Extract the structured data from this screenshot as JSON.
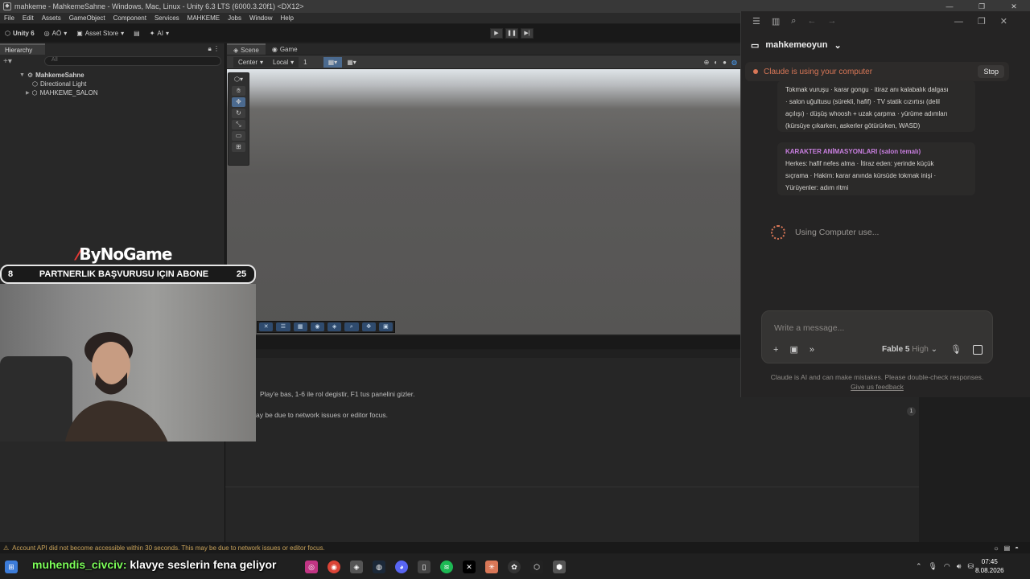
{
  "window": {
    "title": "mahkeme - MahkemeSahne - Windows, Mac, Linux - Unity 6.3 LTS (6000.3.20f1) <DX12>"
  },
  "menu": [
    "File",
    "Edit",
    "Assets",
    "GameObject",
    "Component",
    "Services",
    "MAHKEME",
    "Jobs",
    "Window",
    "Help"
  ],
  "toolbar": {
    "unity": "Unity 6",
    "account": "AÖ",
    "asset_store": "Asset Store",
    "ai": "AI"
  },
  "hierarchy": {
    "tab": "Hierarchy",
    "search_placeholder": "All",
    "scene": "MahkemeSahne",
    "items": [
      "Directional Light",
      "MAHKEME_SALON"
    ]
  },
  "scene": {
    "tabs": [
      "Scene",
      "Game"
    ],
    "pivot": "Center",
    "space": "Local",
    "grid": "1"
  },
  "console": {
    "line1": "Play'e bas, 1-6 ile rol degistir, F1 tus panelini gizler.",
    "line2": "ay be due to network issues or editor focus.",
    "count": "1"
  },
  "status": {
    "text": "Account API did not become accessible within 30 seconds. This may be due to network issues or editor focus."
  },
  "claude": {
    "project": "mahkemeoyun",
    "banner": "Claude is using your computer",
    "stop": "Stop",
    "msg1": [
      "Tokmak vuruşu · karar gongu · itiraz anı kalabalık dalgası",
      "· salon uğultusu (sürekli, hafif) · TV statik cızırtısı (delil",
      "açılışı) · düşüş whoosh + uzak çarpma · yürüme adımları",
      "(kürsüye çıkarken, askerler götürürken, WASD)"
    ],
    "msg2_head": "KARAKTER ANİMASYONLARI (salon temalı)",
    "msg2": [
      "Herkes: hafif nefes alma · İtiraz eden: yerinde küçük",
      "sıçrama · Hakim: karar anında kürsüde tokmak inişi ·",
      "Yürüyenler: adım ritmi"
    ],
    "status": "Using Computer use...",
    "placeholder": "Write a message...",
    "model": "Fable 5",
    "effort": "High",
    "disclaimer": "Claude is AI and can make mistakes. Please double-check responses.",
    "feedback": "Give us feedback"
  },
  "stream": {
    "brand": "ByNoGame",
    "banner_left": "8",
    "banner_text": "PARTNERLIK BAŞVURUSU IÇIN ABONE",
    "banner_right": "25",
    "chat_user": "muhendis_civciv:",
    "chat_text": "klavye seslerin fena geliyor"
  },
  "clock": {
    "time": "07:45",
    "date": "8.08.2026"
  }
}
